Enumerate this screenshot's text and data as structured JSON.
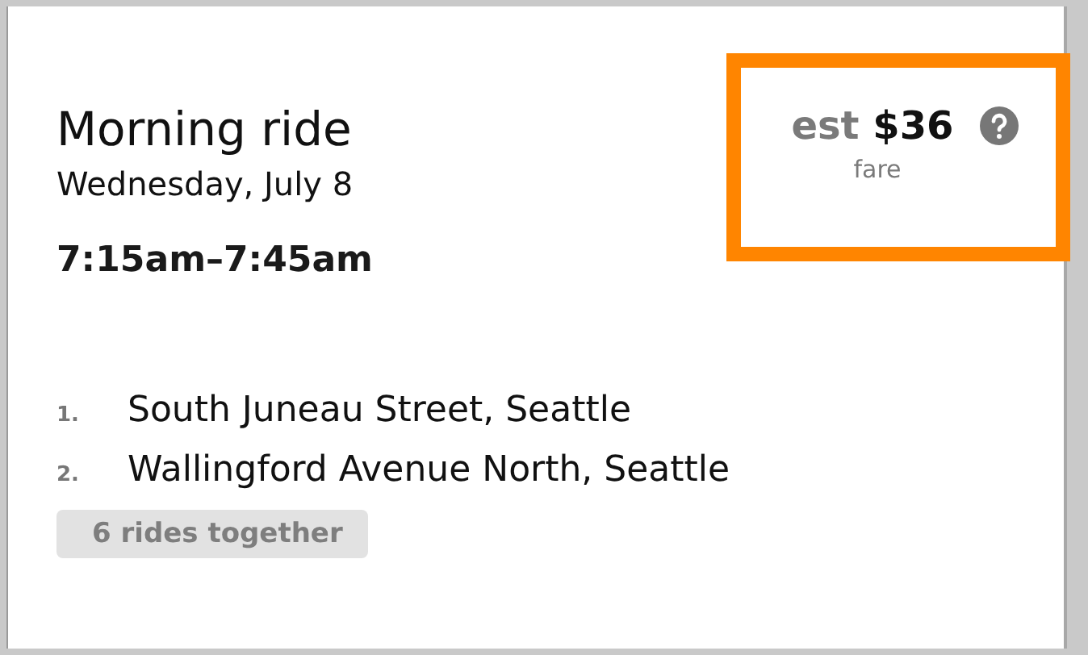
{
  "ride": {
    "title": "Morning ride",
    "date": "Wednesday, July 8",
    "time": "7:15am–7:45am"
  },
  "fare": {
    "prefix": "est",
    "amount": "$36",
    "caption": "fare",
    "highlighted": true
  },
  "stops": [
    {
      "number": "1.",
      "address": "South Juneau Street, Seattle"
    },
    {
      "number": "2.",
      "address": "Wallingford Avenue North, Seattle"
    }
  ],
  "tag": "6 rides together"
}
